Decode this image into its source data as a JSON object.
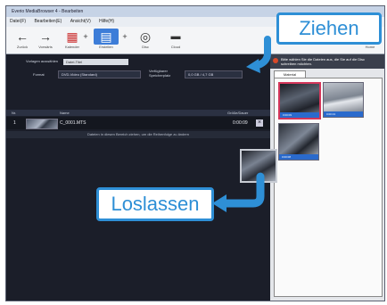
{
  "window": {
    "title": "Everio MediaBrowser 4 - Bearbeiten"
  },
  "menu": [
    "Datei(F)",
    "Bearbeiten(E)",
    "Ansicht(V)",
    "Hilfe(H)"
  ],
  "toolbar": {
    "items": [
      {
        "label": "Zurück",
        "icon": "back-arrow-icon"
      },
      {
        "label": "Vorwärts",
        "icon": "forward-arrow-icon"
      },
      {
        "label": "Kalender",
        "icon": "calendar-icon"
      },
      {
        "label": "",
        "icon": "plus-icon"
      },
      {
        "label": "Erstellen",
        "icon": "create-disc-icon"
      },
      {
        "label": "",
        "icon": "plus-icon"
      },
      {
        "label": "Disc",
        "icon": "disc-icon"
      },
      {
        "label": "Cloud",
        "icon": "cloud-icon"
      }
    ],
    "home_label": "Home"
  },
  "form": {
    "label1": "Vorlagen auswählen",
    "value1": "Datei-Titel",
    "label2": "Format",
    "value2": "DVD-Video (Standard)",
    "label3": "Verfügbarer Speicherplatz",
    "value3": "0,0 GB / 4,7 GB"
  },
  "list": {
    "headers": [
      "Nr.",
      "",
      "Name",
      "Größe/Dauer"
    ],
    "row": {
      "num": "1",
      "name": "C_0001.MTS",
      "size": "0:00:09"
    },
    "notice": "Dateien in diesen Bereich ziehen, um die Reihenfolge zu ändern"
  },
  "right": {
    "info": "Bitte wählen Sie die Dateien aus, die Sie auf die Disc schreiben möchten.",
    "tab": "Material",
    "cells": [
      {
        "label": "0:00:09"
      },
      {
        "label": "0:00:13"
      },
      {
        "label": "0:00:08"
      }
    ]
  },
  "callouts": {
    "drag": "Ziehen",
    "drop": "Loslassen"
  },
  "colors": {
    "accent": "#2e8fd6",
    "selection": "#d4365a",
    "label_blue": "#2a6acc"
  }
}
